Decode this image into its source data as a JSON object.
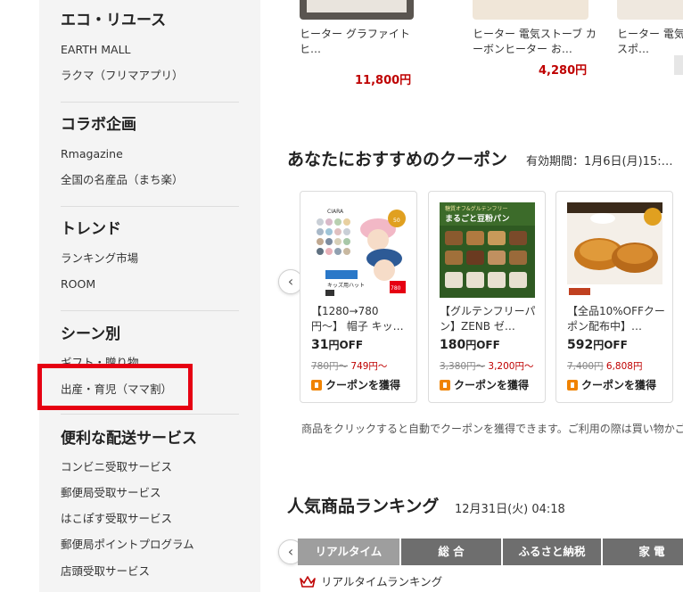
{
  "sidebar": {
    "sections": [
      {
        "title": "エコ・リユース",
        "items": [
          "EARTH MALL",
          "ラクマ（フリマアプリ）"
        ]
      },
      {
        "title": "コラボ企画",
        "items": [
          "Rmagazine",
          "全国の名産品（まち楽）"
        ]
      },
      {
        "title": "トレンド",
        "items": [
          "ランキング市場",
          "ROOM"
        ]
      },
      {
        "title": "シーン別",
        "items": [
          "ギフト・贈り物",
          "出産・育児（ママ割）"
        ]
      },
      {
        "title": "便利な配送サービス",
        "items": [
          "コンビニ受取サービス",
          "郵便局受取サービス",
          "はこぽす受取サービス",
          "郵便局ポイントプログラム",
          "店頭受取サービス"
        ]
      }
    ]
  },
  "top_products": [
    {
      "name": "ヒーター グラファイトヒ…",
      "price": "11,800円"
    },
    {
      "name": "ヒーター 電気ストーブ カーボンヒーター お…",
      "price": "4,280円"
    },
    {
      "name": "ヒーター 電気… ワイド＆スポ…",
      "price": ""
    }
  ],
  "coupon_section": {
    "title": "あなたにおすすめのクーポン",
    "validity": "有効期間：1月6日(月)15:…",
    "cards": [
      {
        "title": "【1280→780円〜】 帽子 キッ…",
        "off": "31",
        "off_unit": "円OFF",
        "old_price": "780円〜",
        "new_price": "749円〜",
        "button": "クーポンを獲得",
        "img_text": "キッズ用ハット"
      },
      {
        "title": "【グルテンフリーパン】ZENB ゼ…",
        "off": "180",
        "off_unit": "円OFF",
        "old_price": "3,380円〜",
        "new_price": "3,200円〜",
        "button": "クーポンを獲得",
        "img_text": "まるごと豆粉パン"
      },
      {
        "title": "【全品10%OFFクーポン配布中】…",
        "off": "592",
        "off_unit": "円OFF",
        "old_price": "7,400円",
        "new_price": "6,808円",
        "button": "クーポンを獲得",
        "img_text": ""
      }
    ],
    "note": "商品をクリックすると自動でクーポンを獲得できます。ご利用の際は買い物かご…"
  },
  "ranking": {
    "title": "人気商品ランキング",
    "timestamp": "12月31日(火) 04:18",
    "tabs": [
      "リアルタイム",
      "総 合",
      "ふるさと納税",
      "家 電"
    ],
    "label": "リアルタイムランキング"
  },
  "colors": {
    "price_red": "#bf0000",
    "highlight": "#e60012",
    "tab_dark": "#6e6e6e",
    "tab_active": "#9e9e9e",
    "ticket": "#f08300"
  }
}
